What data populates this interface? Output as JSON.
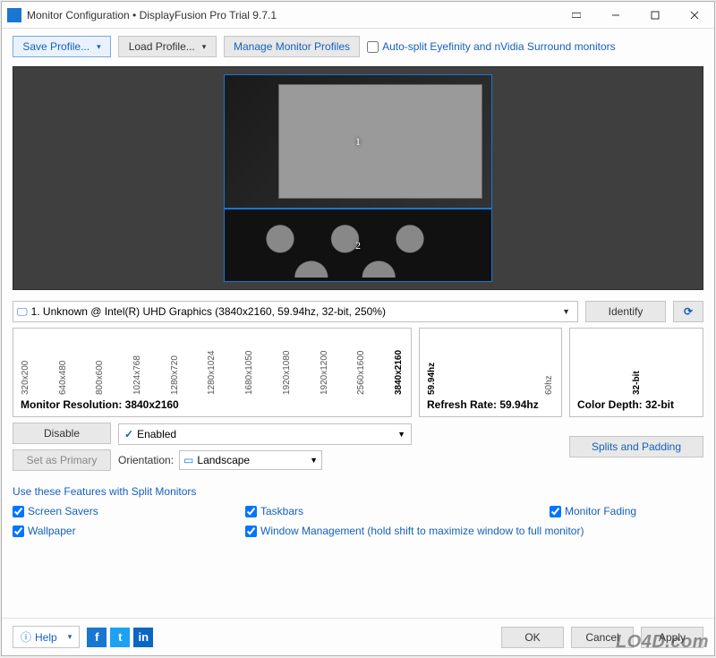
{
  "window": {
    "title": "Monitor Configuration • DisplayFusion Pro Trial 9.7.1"
  },
  "toolbar": {
    "save_profile": "Save Profile...",
    "load_profile": "Load Profile...",
    "manage_profiles": "Manage Monitor Profiles",
    "auto_split": "Auto-split Eyefinity and nVidia Surround monitors"
  },
  "preview": {
    "monitor1_label": "1",
    "monitor2_label": "2"
  },
  "monitor_selector": {
    "text": "1. Unknown @ Intel(R) UHD Graphics (3840x2160, 59.94hz, 32-bit, 250%)",
    "identify": "Identify"
  },
  "resolution": {
    "ticks": [
      "320x200",
      "640x480",
      "800x600",
      "1024x768",
      "1280x720",
      "1280x1024",
      "1680x1050",
      "1920x1080",
      "1920x1200",
      "2560x1600",
      "3840x2160"
    ],
    "selected": "3840x2160",
    "label_prefix": "Monitor Resolution: ",
    "label_value": "3840x2160"
  },
  "refresh": {
    "ticks": [
      "59.94hz",
      "60hz"
    ],
    "selected": "59.94hz",
    "label_prefix": "Refresh Rate: ",
    "label_value": "59.94hz"
  },
  "depth": {
    "ticks": [
      "32-bit"
    ],
    "selected": "32-bit",
    "label_prefix": "Color Depth: ",
    "label_value": "32-bit"
  },
  "actions": {
    "disable": "Disable",
    "set_primary": "Set as Primary",
    "enabled": "Enabled",
    "orientation_label": "Orientation:",
    "orientation_value": "Landscape",
    "splits": "Splits and Padding"
  },
  "features": {
    "title": "Use these Features with Split Monitors",
    "screen_savers": "Screen Savers",
    "wallpaper": "Wallpaper",
    "taskbars": "Taskbars",
    "window_mgmt": "Window Management (hold shift to maximize window to full monitor)",
    "monitor_fading": "Monitor Fading"
  },
  "footer": {
    "help": "Help",
    "ok": "OK",
    "cancel": "Cancel",
    "apply": "Apply"
  },
  "watermark": "LO4D.com"
}
